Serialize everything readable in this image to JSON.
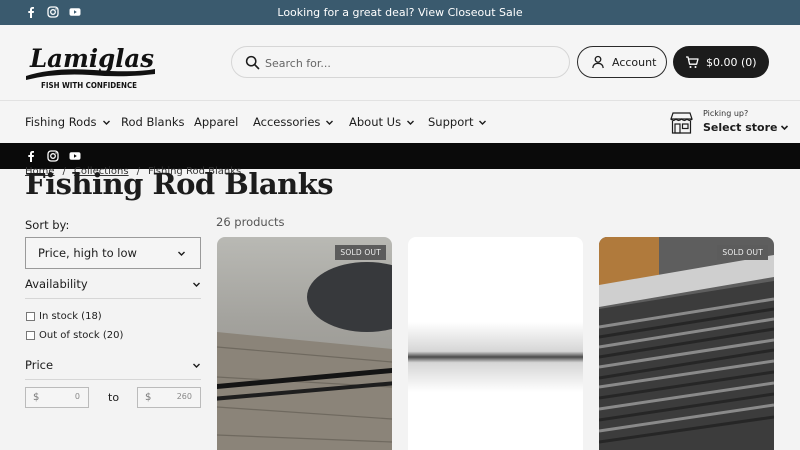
{
  "announcement": {
    "text": "Looking for a great deal? View Closeout Sale"
  },
  "social_icons": [
    "facebook-icon",
    "instagram-icon",
    "youtube-icon"
  ],
  "brand": {
    "name": "Lamiglas",
    "tagline": "FISH WITH CONFIDENCE"
  },
  "search": {
    "placeholder": "Search for..."
  },
  "account": {
    "label": "Account"
  },
  "cart": {
    "label": "$0.00 (0)"
  },
  "nav": {
    "items": [
      {
        "label": "Fishing Rods",
        "has_dropdown": true
      },
      {
        "label": "Rod Blanks",
        "has_dropdown": false
      },
      {
        "label": "Apparel",
        "has_dropdown": false
      },
      {
        "label": "Accessories",
        "has_dropdown": true
      },
      {
        "label": "About Us",
        "has_dropdown": true
      },
      {
        "label": "Support",
        "has_dropdown": true
      }
    ],
    "store": {
      "picking": "Picking up?",
      "select": "Select store"
    }
  },
  "breadcrumb": [
    "Home",
    "Collections",
    "Fishing Rod Blanks"
  ],
  "page_title": "Fishing Rod Blanks",
  "filters": {
    "sort_label": "Sort by:",
    "sort_value": "Price, high to low",
    "availability": {
      "label": "Availability",
      "options": [
        "In stock (18)",
        "Out of stock (20)"
      ]
    },
    "price": {
      "label": "Price",
      "currency": "$",
      "min_placeholder": "0",
      "max_placeholder": "260",
      "to": "to"
    }
  },
  "products": {
    "count_text": "26 products",
    "cards": [
      {
        "badge": "SOLD OUT"
      },
      {
        "badge": ""
      },
      {
        "badge": "SOLD OUT"
      }
    ]
  },
  "colors": {
    "announcement_bg": "#3a5a6e",
    "cart_bg": "#1c1c1c",
    "blackbar_bg": "#0a0a0a",
    "page_bg": "#f3f3f3"
  }
}
